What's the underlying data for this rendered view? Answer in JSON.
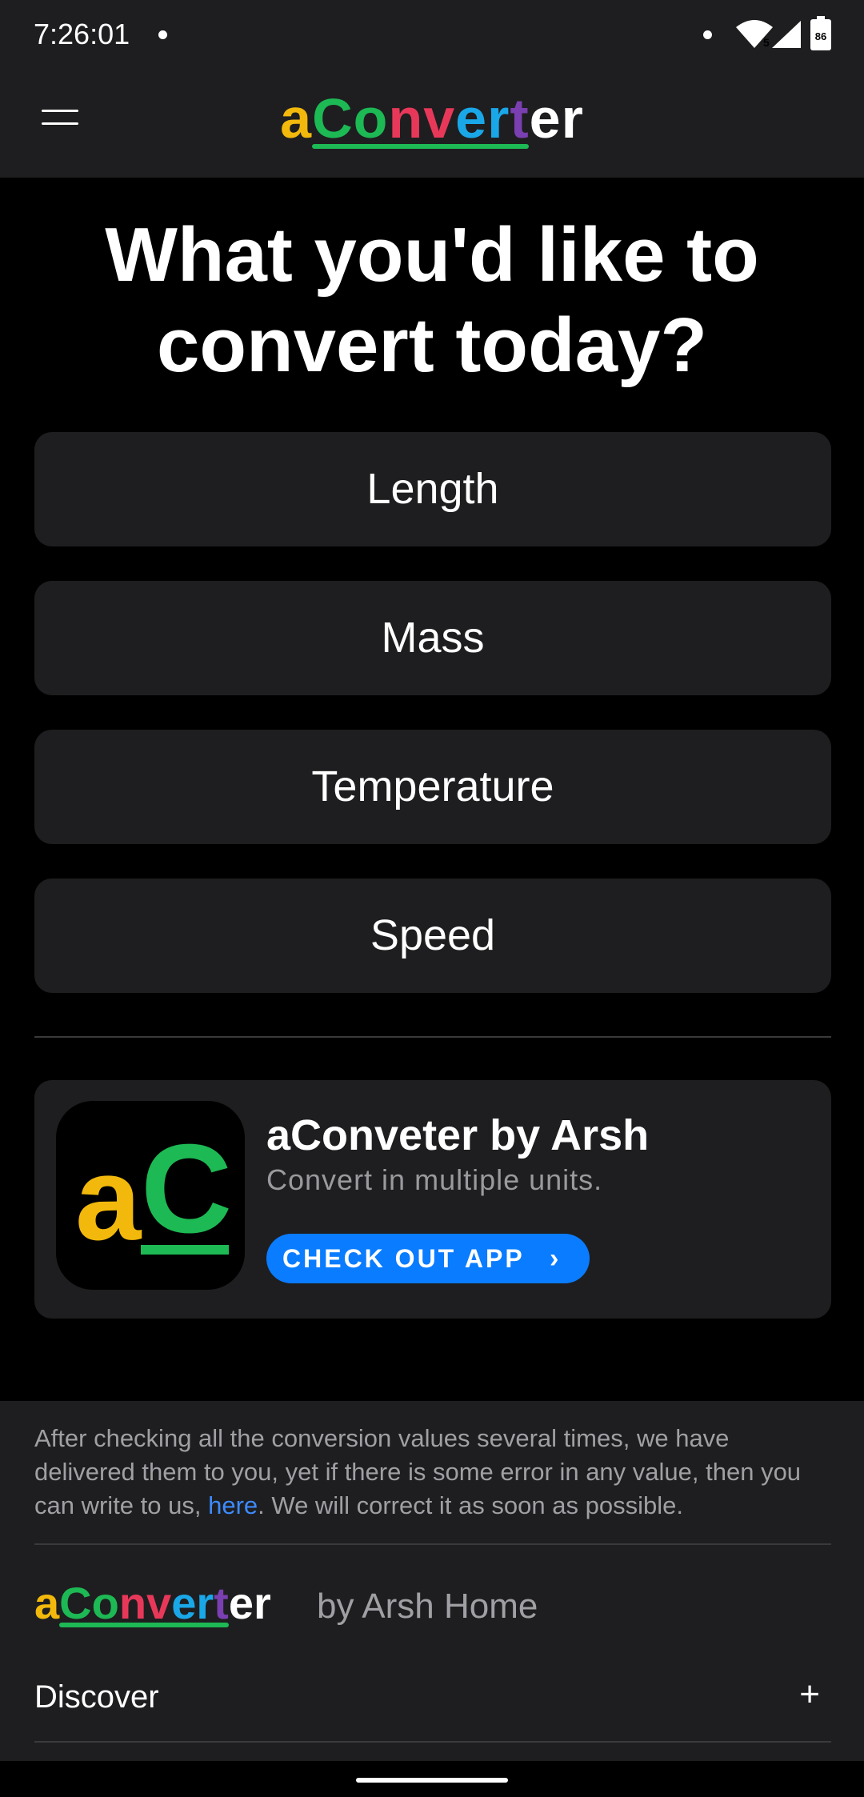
{
  "status_bar": {
    "time": "7:26:01",
    "battery": "86",
    "wifi_badge": "5"
  },
  "header": {
    "logo_letters": [
      {
        "ch": "a",
        "color": "#f2b90c"
      },
      {
        "ch": "C",
        "color": "#1db954"
      },
      {
        "ch": "o",
        "color": "#1db954"
      },
      {
        "ch": "n",
        "color": "#e8385a"
      },
      {
        "ch": "v",
        "color": "#e8385a"
      },
      {
        "ch": "e",
        "color": "#1aa7e8"
      },
      {
        "ch": "r",
        "color": "#1aa7e8"
      },
      {
        "ch": "t",
        "color": "#7a3fb0"
      },
      {
        "ch": "e",
        "color": "#ffffff"
      },
      {
        "ch": "r",
        "color": "#ffffff"
      }
    ],
    "menu_icon": "hamburger-icon"
  },
  "main": {
    "title_line1": "What you'd like to",
    "title_line2": "convert today?",
    "categories": [
      "Length",
      "Mass",
      "Temperature",
      "Speed"
    ]
  },
  "app_card": {
    "icon_letter_a": "a",
    "icon_letter_c": "C",
    "title": "aConveter by Arsh",
    "subtitle": "Convert in multiple units.",
    "cta": "CHECK OUT APP",
    "cta_arrow": "›"
  },
  "footer": {
    "disclaimer_before": "After checking all the conversion values several times, we have delivered them to you, yet if there is some error in any value, then you can write to us, ",
    "disclaimer_link": "here",
    "disclaimer_after": ". We will correct it as soon as possible.",
    "byline": "by Arsh Home",
    "discover_label": "Discover",
    "discover_toggle": "+"
  },
  "colors": {
    "accent_blue": "#0a7cff",
    "link_blue": "#3d8bfd",
    "surface": "#1e1e20"
  }
}
